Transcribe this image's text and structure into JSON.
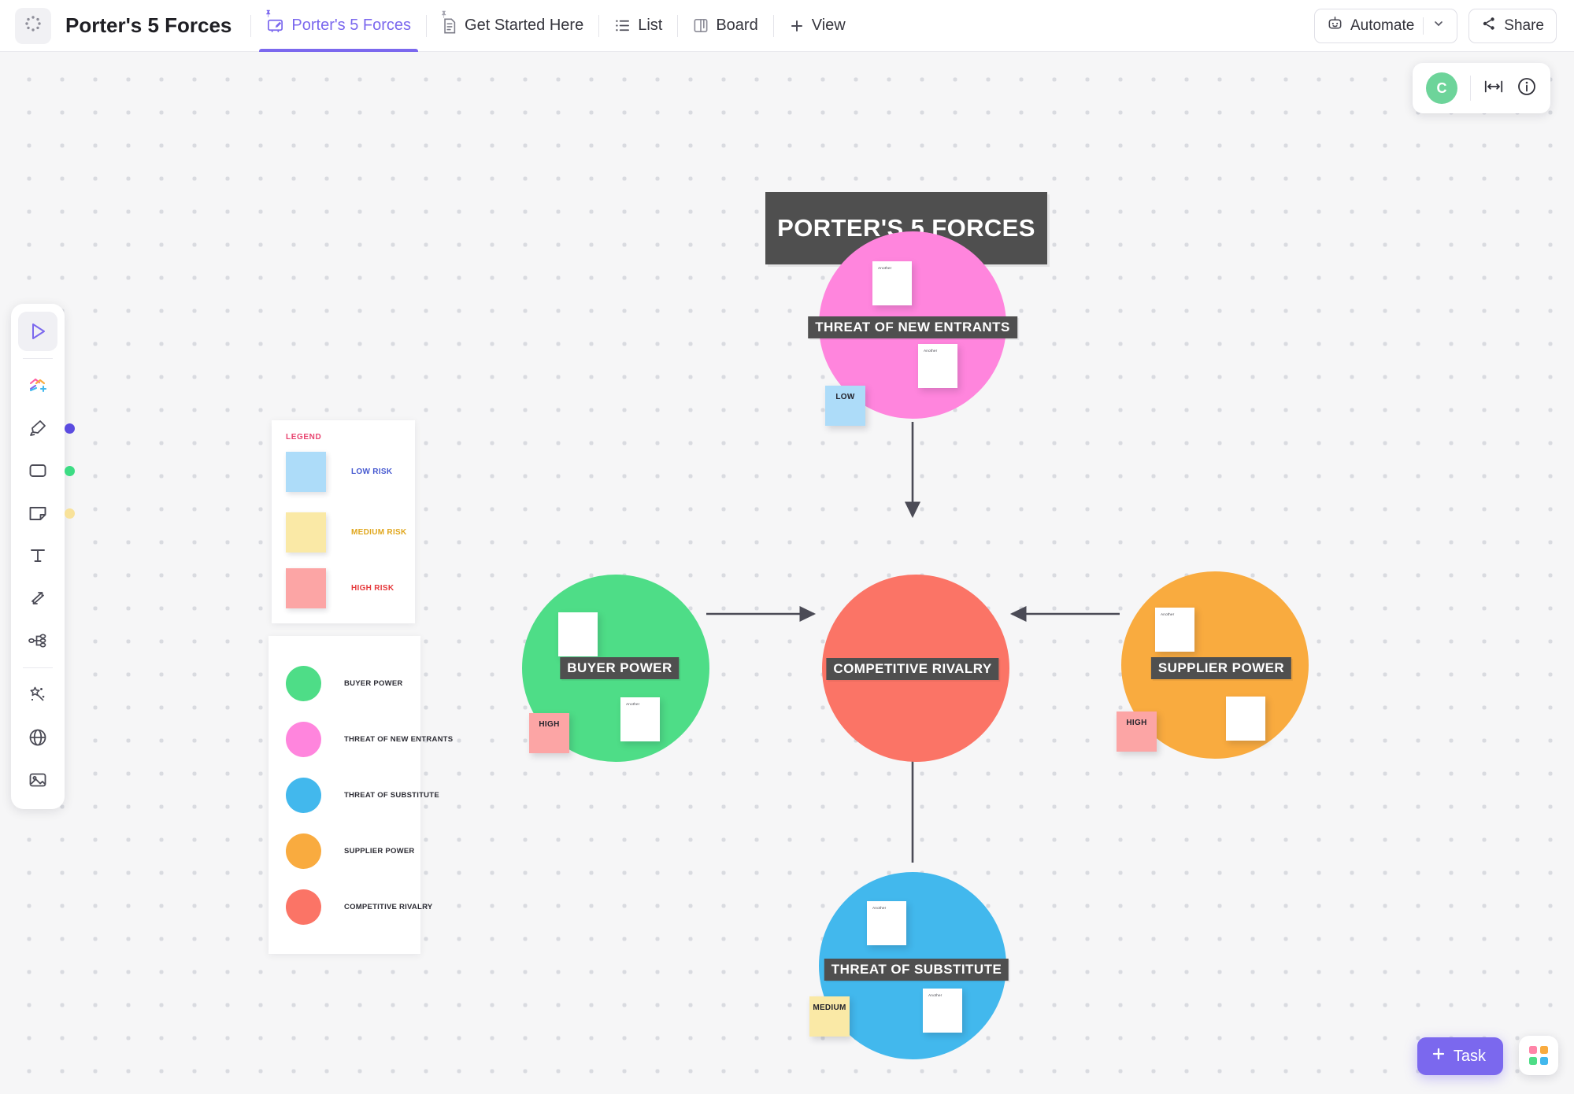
{
  "topbar": {
    "doc_title": "Porter's 5 Forces",
    "app_icon": "clickup-dots-icon",
    "tabs": [
      {
        "label": "Porter's 5 Forces",
        "icon": "whiteboard-icon",
        "pinned": true,
        "active": true
      },
      {
        "label": "Get Started Here",
        "icon": "doc-icon",
        "pinned": true,
        "active": false
      },
      {
        "label": "List",
        "icon": "list-icon",
        "pinned": false,
        "active": false
      },
      {
        "label": "Board",
        "icon": "board-icon",
        "pinned": false,
        "active": false
      },
      {
        "label": "View",
        "icon": "plus-icon",
        "pinned": false,
        "active": false
      }
    ],
    "automate_label": "Automate",
    "automate_icon": "robot-icon",
    "automate_caret": "chevron-down-icon",
    "share_label": "Share",
    "share_icon": "share-icon"
  },
  "userbar": {
    "avatar_initial": "C",
    "avatar_color": "#6dd49a",
    "fit_icon": "fit-to-screen-icon",
    "info_icon": "info-circle-icon"
  },
  "toolbar": {
    "items": [
      {
        "name": "select-tool",
        "icon": "cursor-arrow-icon",
        "selected": true,
        "chip": null
      },
      {
        "name": "templates-tool",
        "icon": "shapes-plus-icon",
        "selected": false,
        "chip": null
      },
      {
        "name": "pen-tool",
        "icon": "marker-pen-icon",
        "selected": false,
        "chip": "#5b4ce0"
      },
      {
        "name": "shape-tool",
        "icon": "rounded-square-icon",
        "selected": false,
        "chip": "#3ddc84"
      },
      {
        "name": "sticky-note-tool",
        "icon": "sticky-note-icon",
        "selected": false,
        "chip": "#f8e29a"
      },
      {
        "name": "text-tool",
        "icon": "text-t-icon",
        "selected": false,
        "chip": null
      },
      {
        "name": "connector-tool",
        "icon": "connector-arrows-icon",
        "selected": false,
        "chip": null
      },
      {
        "name": "mindmap-tool",
        "icon": "mindmap-icon",
        "selected": false,
        "chip": null
      },
      {
        "name": "ai-tool",
        "icon": "magic-wand-icon",
        "selected": false,
        "chip": null
      },
      {
        "name": "embed-tool",
        "icon": "globe-icon",
        "selected": false,
        "chip": null
      },
      {
        "name": "image-tool",
        "icon": "image-icon",
        "selected": false,
        "chip": null
      }
    ]
  },
  "board": {
    "title": "PORTER'S 5 FORCES",
    "title_bg": "#4f4f4f"
  },
  "legend_risk": {
    "heading": "LEGEND",
    "items": [
      {
        "label": "LOW RISK",
        "color": "#addcf9",
        "text_color": "#4558d0"
      },
      {
        "label": "MEDIUM RISK",
        "color": "#fae9a6",
        "text_color": "#e0a61c"
      },
      {
        "label": "HIGH RISK",
        "color": "#fca5a5",
        "text_color": "#e5383b"
      }
    ]
  },
  "legend_force": {
    "items": [
      {
        "label": "BUYER POWER",
        "color": "#4edd87"
      },
      {
        "label": "THREAT OF NEW ENTRANTS",
        "color": "#ff85dd"
      },
      {
        "label": "THREAT OF SUBSTITUTE",
        "color": "#42b8ed"
      },
      {
        "label": "SUPPLIER POWER",
        "color": "#f9ab3f"
      },
      {
        "label": "COMPETITIVE RIVALRY",
        "color": "#fb7466"
      }
    ]
  },
  "diagram": {
    "nodes": [
      {
        "id": "threat-new-entrants",
        "label": "THREAT OF NEW ENTRANTS",
        "color": "#ff85dd",
        "tag": {
          "label": "LOW",
          "color": "#addcf9"
        },
        "notes": [
          {
            "text": "Another"
          },
          {
            "text": "Another"
          }
        ]
      },
      {
        "id": "buyer-power",
        "label": "BUYER POWER",
        "color": "#4edd87",
        "tag": {
          "label": "HIGH",
          "color": "#fca5a5"
        },
        "notes": [
          {
            "text": ""
          },
          {
            "text": "Another"
          }
        ]
      },
      {
        "id": "competitive-rivalry",
        "label": "COMPETITIVE RIVALRY",
        "color": "#fb7466",
        "tag": null,
        "notes": []
      },
      {
        "id": "supplier-power",
        "label": "SUPPLIER POWER",
        "color": "#f9ab3f",
        "tag": {
          "label": "HIGH",
          "color": "#fca5a5"
        },
        "notes": [
          {
            "text": "Another"
          },
          {
            "text": ""
          }
        ]
      },
      {
        "id": "threat-of-substitute",
        "label": "THREAT OF SUBSTITUTE",
        "color": "#42b8ed",
        "tag": {
          "label": "MEDIUM",
          "color": "#fae9a6"
        },
        "notes": [
          {
            "text": "Another"
          },
          {
            "text": "Another"
          }
        ]
      }
    ],
    "connectors": [
      {
        "from": "threat-new-entrants",
        "to": "competitive-rivalry",
        "direction": "down"
      },
      {
        "from": "buyer-power",
        "to": "competitive-rivalry",
        "direction": "right"
      },
      {
        "from": "supplier-power",
        "to": "competitive-rivalry",
        "direction": "left"
      },
      {
        "from": "threat-of-substitute",
        "to": "competitive-rivalry",
        "direction": "up"
      }
    ]
  },
  "footer": {
    "task_label": "Task",
    "task_plus_icon": "plus-icon",
    "apps_icon": "apps-grid-icon"
  }
}
